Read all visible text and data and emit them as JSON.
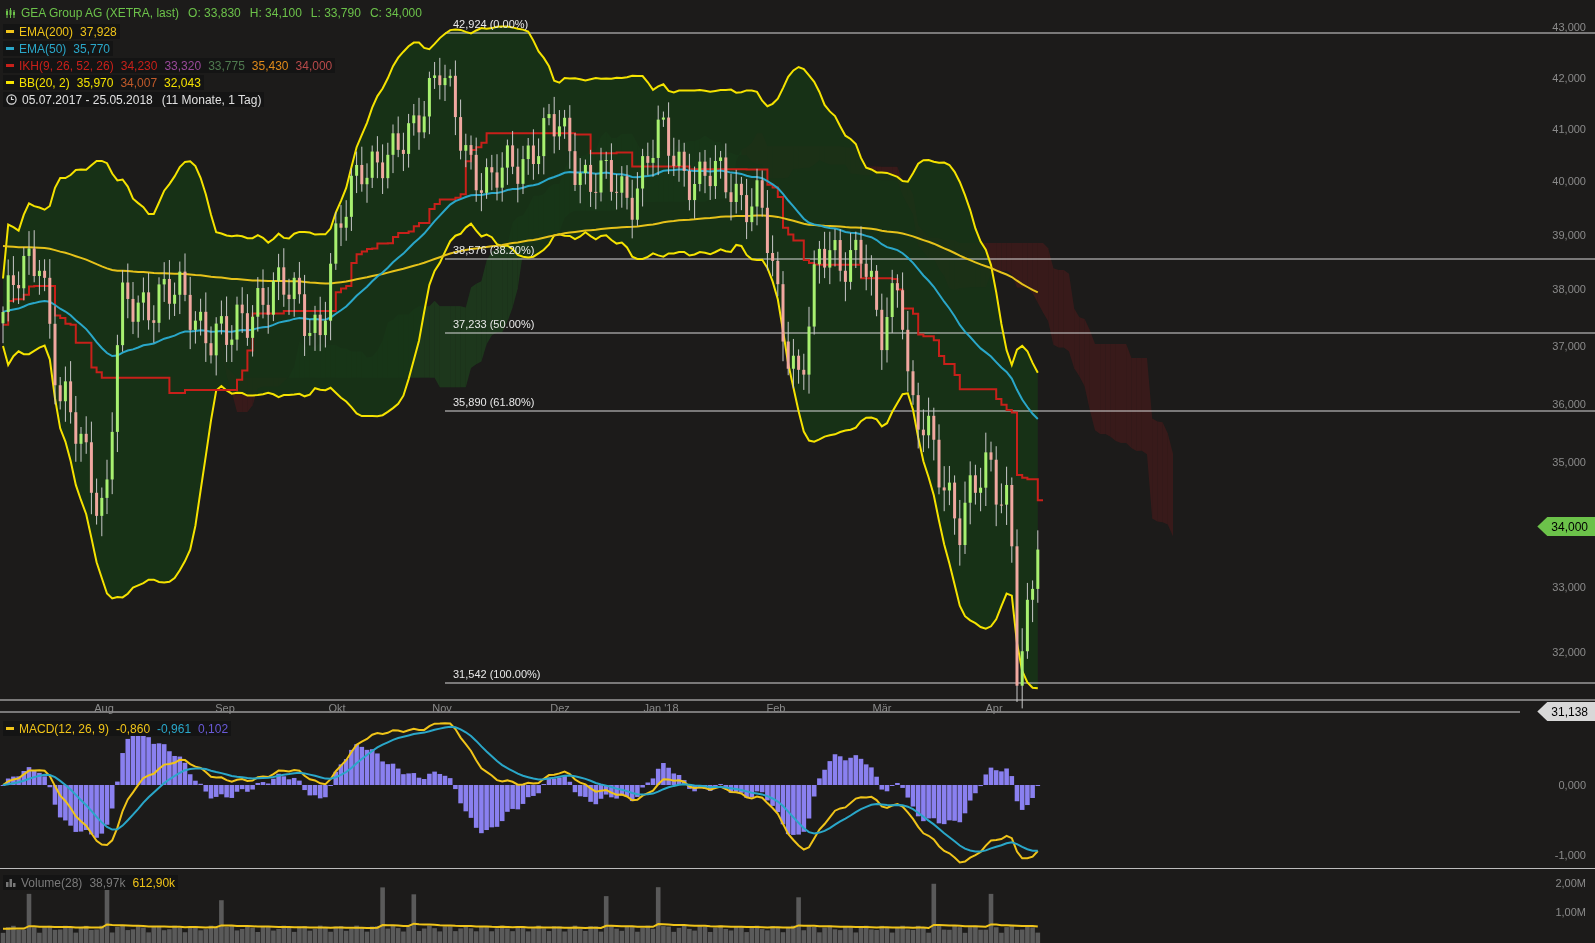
{
  "instrument": {
    "name": "GEA Group AG (XETRA, last)",
    "quotes": [
      "O: 33,830",
      "H: 34,100",
      "L: 33,790",
      "C: 34,000"
    ]
  },
  "indicators": [
    {
      "name": "EMA(200)",
      "color": "#f0c419",
      "values": [
        {
          "text": "37,928",
          "color": "#f0c419"
        }
      ]
    },
    {
      "name": "EMA(50)",
      "color": "#2aa7c9",
      "values": [
        {
          "text": "35,770",
          "color": "#2aa7c9"
        }
      ]
    },
    {
      "name": "IKH(9, 26, 52, 26)",
      "color": "#c8201a",
      "values": [
        {
          "text": "34,230",
          "color": "#c8201a"
        },
        {
          "text": "33,320",
          "color": "#9a4a9a"
        },
        {
          "text": "33,775",
          "color": "#4f7a4f"
        },
        {
          "text": "35,430",
          "color": "#e08a1a"
        },
        {
          "text": "34,000",
          "color": "#b84a4a"
        }
      ]
    },
    {
      "name": "BB(20, 2)",
      "color": "#f5e300",
      "values": [
        {
          "text": "35,970",
          "color": "#f5e300"
        },
        {
          "text": "34,007",
          "color": "#c05a2a"
        },
        {
          "text": "32,043",
          "color": "#f5e300"
        }
      ]
    }
  ],
  "period": {
    "range": "05.07.2017 - 25.05.2018",
    "duration": "(11 Monate, 1 Tag)"
  },
  "fib_levels": [
    "42,924 (0.00%)",
    "38,576 (38.20%)",
    "37,233 (50.00%)",
    "35,890 (61.80%)",
    "31,542 (100.00%)"
  ],
  "price_axis": [
    "43,000",
    "42,000",
    "41,000",
    "40,000",
    "39,000",
    "38,000",
    "37,000",
    "36,000",
    "35,000",
    "33,000",
    "32,000"
  ],
  "last_price": "34,000",
  "cursor_price": "31,138",
  "x_axis": [
    "Aug",
    "Sep",
    "Okt",
    "Nov",
    "Dez",
    "Jan '18",
    "Feb",
    "Mär",
    "Apr"
  ],
  "macd": {
    "name": "MACD(12, 26, 9)",
    "values": [
      {
        "text": "-0,860",
        "color": "#f0c419"
      },
      {
        "text": "-0,961",
        "color": "#2aa7c9"
      },
      {
        "text": "0,102",
        "color": "#6a5ad8"
      }
    ]
  },
  "macd_axis": [
    "0,000",
    "-1,000"
  ],
  "volume": {
    "name": "Volume(28)",
    "values": [
      {
        "text": "38,97k",
        "color": "#7a7a7a"
      },
      {
        "text": "612,90k",
        "color": "#f0c419"
      }
    ]
  },
  "volume_axis": [
    "2,00M",
    "1,00M"
  ]
}
